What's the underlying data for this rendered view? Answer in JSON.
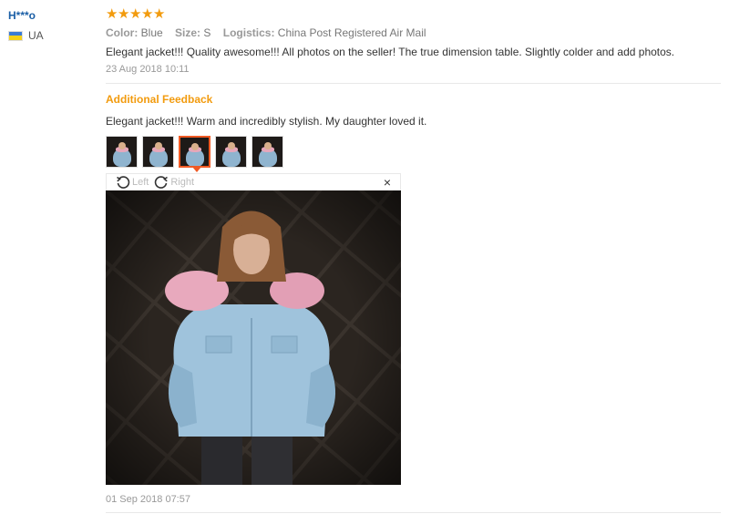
{
  "user": {
    "name": "H***o",
    "country": "UA"
  },
  "rating": {
    "stars": 5,
    "color": "#f29b0e"
  },
  "attributes": {
    "color_key": "Color:",
    "color_val": "Blue",
    "size_key": "Size:",
    "size_val": "S",
    "logistics_key": "Logistics:",
    "logistics_val": "China Post Registered Air Mail"
  },
  "review": {
    "text": "Elegant jacket!!! Quality awesome!!! All photos on the seller! The true dimension table. Slightly colder and add photos.",
    "date": "23 Aug 2018 10:11"
  },
  "additional": {
    "title": "Additional Feedback",
    "text": "Elegant jacket!!! Warm and incredibly stylish. My daughter loved it.",
    "date": "01 Sep 2018 07:57",
    "thumb_count": 5,
    "active_thumb": 3
  },
  "viewer": {
    "rotate_left": "Left",
    "rotate_right": "Right",
    "close": "×"
  },
  "icons": [
    "star-icon",
    "rotate-left-icon",
    "rotate-right-icon",
    "close-icon",
    "flag-ua-icon"
  ],
  "colors": {
    "accent": "#f29b0e",
    "active_border": "#f05a24",
    "link": "#1b5fa6"
  }
}
